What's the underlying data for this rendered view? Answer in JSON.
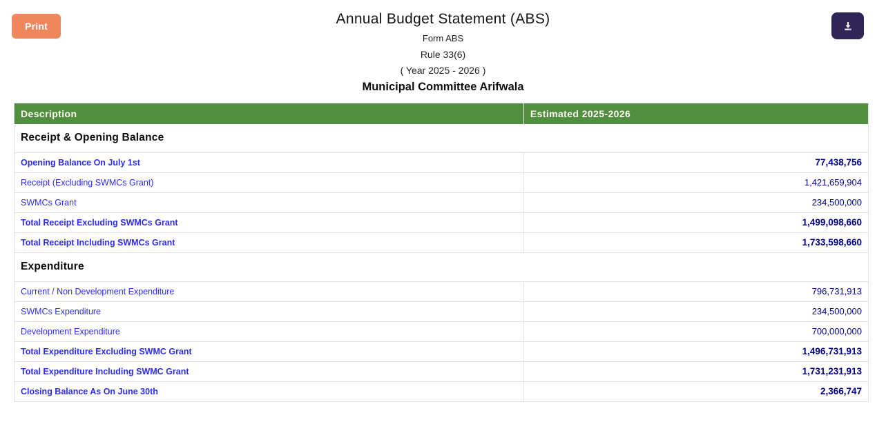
{
  "page": {
    "title": "Annual Budget Statement (ABS)",
    "form_line": "Form ABS",
    "rule_line": "Rule 33(6)",
    "year_line": "( Year 2025 - 2026 )",
    "committee": "Municipal Committee Arifwala"
  },
  "toolbar": {
    "print_label": "Print",
    "download_icon": "download-icon"
  },
  "colors": {
    "table_header_green": "#4f8f3d",
    "print_button_orange": "#f0875c",
    "download_button_purple": "#2f2557",
    "row_label_blue": "#2d2df5",
    "row_value_navy": "#00008b"
  },
  "table": {
    "columns": [
      "Description",
      "Estimated 2025-2026"
    ],
    "sections": [
      {
        "title": "Receipt & Opening Balance",
        "rows": [
          {
            "label": "Opening Balance On July 1st",
            "value": "77,438,756",
            "bold": true
          },
          {
            "label": "Receipt (Excluding SWMCs Grant)",
            "value": "1,421,659,904",
            "bold": false
          },
          {
            "label": "SWMCs Grant",
            "value": "234,500,000",
            "bold": false
          },
          {
            "label": "Total Receipt Excluding SWMCs Grant",
            "value": "1,499,098,660",
            "bold": true
          },
          {
            "label": "Total Receipt Including SWMCs Grant",
            "value": "1,733,598,660",
            "bold": true
          }
        ]
      },
      {
        "title": "Expenditure",
        "rows": [
          {
            "label": "Current / Non Development Expenditure",
            "value": "796,731,913",
            "bold": false
          },
          {
            "label": "SWMCs Expenditure",
            "value": "234,500,000",
            "bold": false
          },
          {
            "label": "Development Expenditure",
            "value": "700,000,000",
            "bold": false
          },
          {
            "label": "Total Expenditure Excluding SWMC Grant",
            "value": "1,496,731,913",
            "bold": true
          },
          {
            "label": "Total Expenditure Including SWMC Grant",
            "value": "1,731,231,913",
            "bold": true
          },
          {
            "label": "Closing Balance As On June 30th",
            "value": "2,366,747",
            "bold": true
          }
        ]
      }
    ]
  }
}
